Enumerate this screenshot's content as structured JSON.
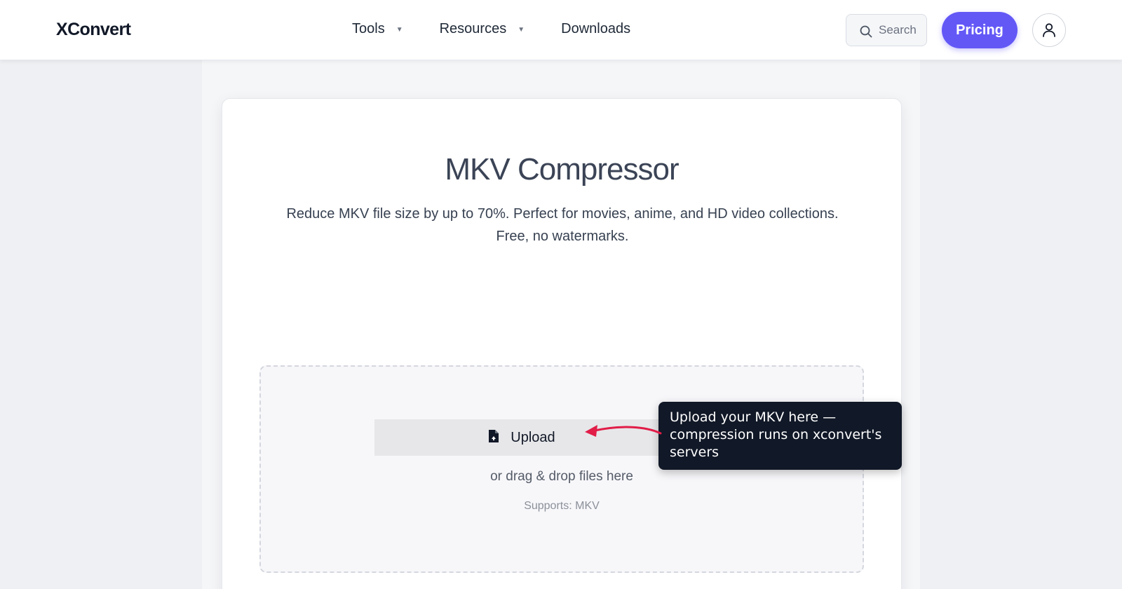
{
  "header": {
    "logo": "XConvert",
    "nav": [
      {
        "label": "Tools",
        "has_dropdown": true
      },
      {
        "label": "Resources",
        "has_dropdown": true
      },
      {
        "label": "Downloads",
        "has_dropdown": false
      }
    ],
    "caret_glyph": "▼",
    "search_label": "Search",
    "pricing_label": "Pricing",
    "icons": {
      "search": "search-icon",
      "user": "user-icon",
      "caret": "caret-down-icon"
    }
  },
  "main": {
    "title": "MKV Compressor",
    "subtitle_line1": "Reduce MKV file size by up to 70%. Perfect for movies, anime, and HD video collections.",
    "subtitle_line2": "Free, no watermarks.",
    "dropzone": {
      "upload_label": "Upload",
      "drag_text": "or drag & drop files here",
      "supports_text": "Supports: MKV",
      "icon": "file-icon"
    }
  },
  "annotation": {
    "tooltip_text": "Upload your MKV here — compression runs on xconvert's servers",
    "arrow_color": "#e11d48"
  },
  "colors": {
    "accent": "#6358f6",
    "tooltip_bg": "#111827",
    "page_bg": "#eef0f4"
  }
}
